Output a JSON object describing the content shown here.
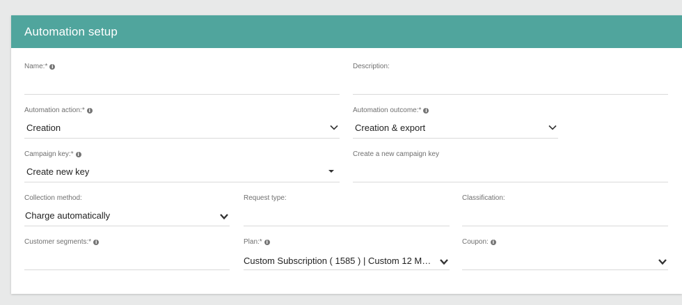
{
  "header": {
    "title": "Automation setup"
  },
  "fields": {
    "name": {
      "label": "Name:*",
      "value": ""
    },
    "description": {
      "label": "Description:",
      "value": ""
    },
    "automation_action": {
      "label": "Automation action:*",
      "value": "Creation"
    },
    "automation_outcome": {
      "label": "Automation outcome:*",
      "value": "Creation & export"
    },
    "campaign_key": {
      "label": "Campaign key:*",
      "value": "Create new key"
    },
    "new_campaign_key": {
      "label": "Create a new campaign key",
      "value": ""
    },
    "collection_method": {
      "label": "Collection method:",
      "value": "Charge automatically"
    },
    "request_type": {
      "label": "Request type:",
      "value": ""
    },
    "classification": {
      "label": "Classification:",
      "value": ""
    },
    "customer_segments": {
      "label": "Customer segments:*",
      "value": ""
    },
    "plan": {
      "label": "Plan:*",
      "value": "Custom Subscription ( 1585 ) | Custom 12 Mon..."
    },
    "coupon": {
      "label": "Coupon:",
      "value": ""
    }
  },
  "icons": {
    "info": "info-icon",
    "chevron": "chevron-down-icon",
    "caret": "caret-down-icon"
  },
  "colors": {
    "header": "#50a59d",
    "background": "#e8e9e9"
  }
}
